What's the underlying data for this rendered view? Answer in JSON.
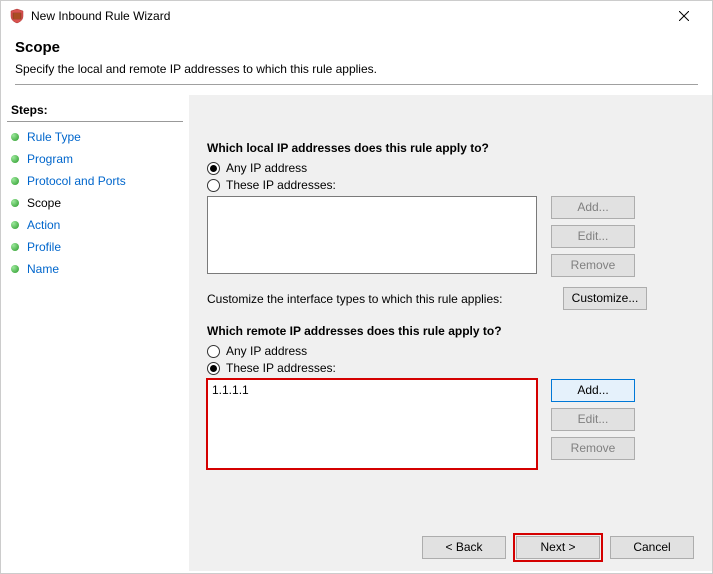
{
  "window": {
    "title": "New Inbound Rule Wizard",
    "close_label": "Close"
  },
  "header": {
    "title": "Scope",
    "subtitle": "Specify the local and remote IP addresses to which this rule applies."
  },
  "sidebar": {
    "title": "Steps:",
    "items": [
      {
        "label": "Rule Type",
        "current": false
      },
      {
        "label": "Program",
        "current": false
      },
      {
        "label": "Protocol and Ports",
        "current": false
      },
      {
        "label": "Scope",
        "current": true
      },
      {
        "label": "Action",
        "current": false
      },
      {
        "label": "Profile",
        "current": false
      },
      {
        "label": "Name",
        "current": false
      }
    ]
  },
  "local": {
    "question": "Which local IP addresses does this rule apply to?",
    "any_label": "Any IP address",
    "these_label": "These IP addresses:",
    "selected": "any",
    "addresses": [],
    "buttons": {
      "add": "Add...",
      "edit": "Edit...",
      "remove": "Remove"
    }
  },
  "customize": {
    "text": "Customize the interface types to which this rule applies:",
    "button": "Customize..."
  },
  "remote": {
    "question": "Which remote IP addresses does this rule apply to?",
    "any_label": "Any IP address",
    "these_label": "These IP addresses:",
    "selected": "these",
    "addresses": [
      "1.1.1.1"
    ],
    "buttons": {
      "add": "Add...",
      "edit": "Edit...",
      "remove": "Remove"
    }
  },
  "footer": {
    "back": "< Back",
    "next": "Next >",
    "cancel": "Cancel"
  }
}
